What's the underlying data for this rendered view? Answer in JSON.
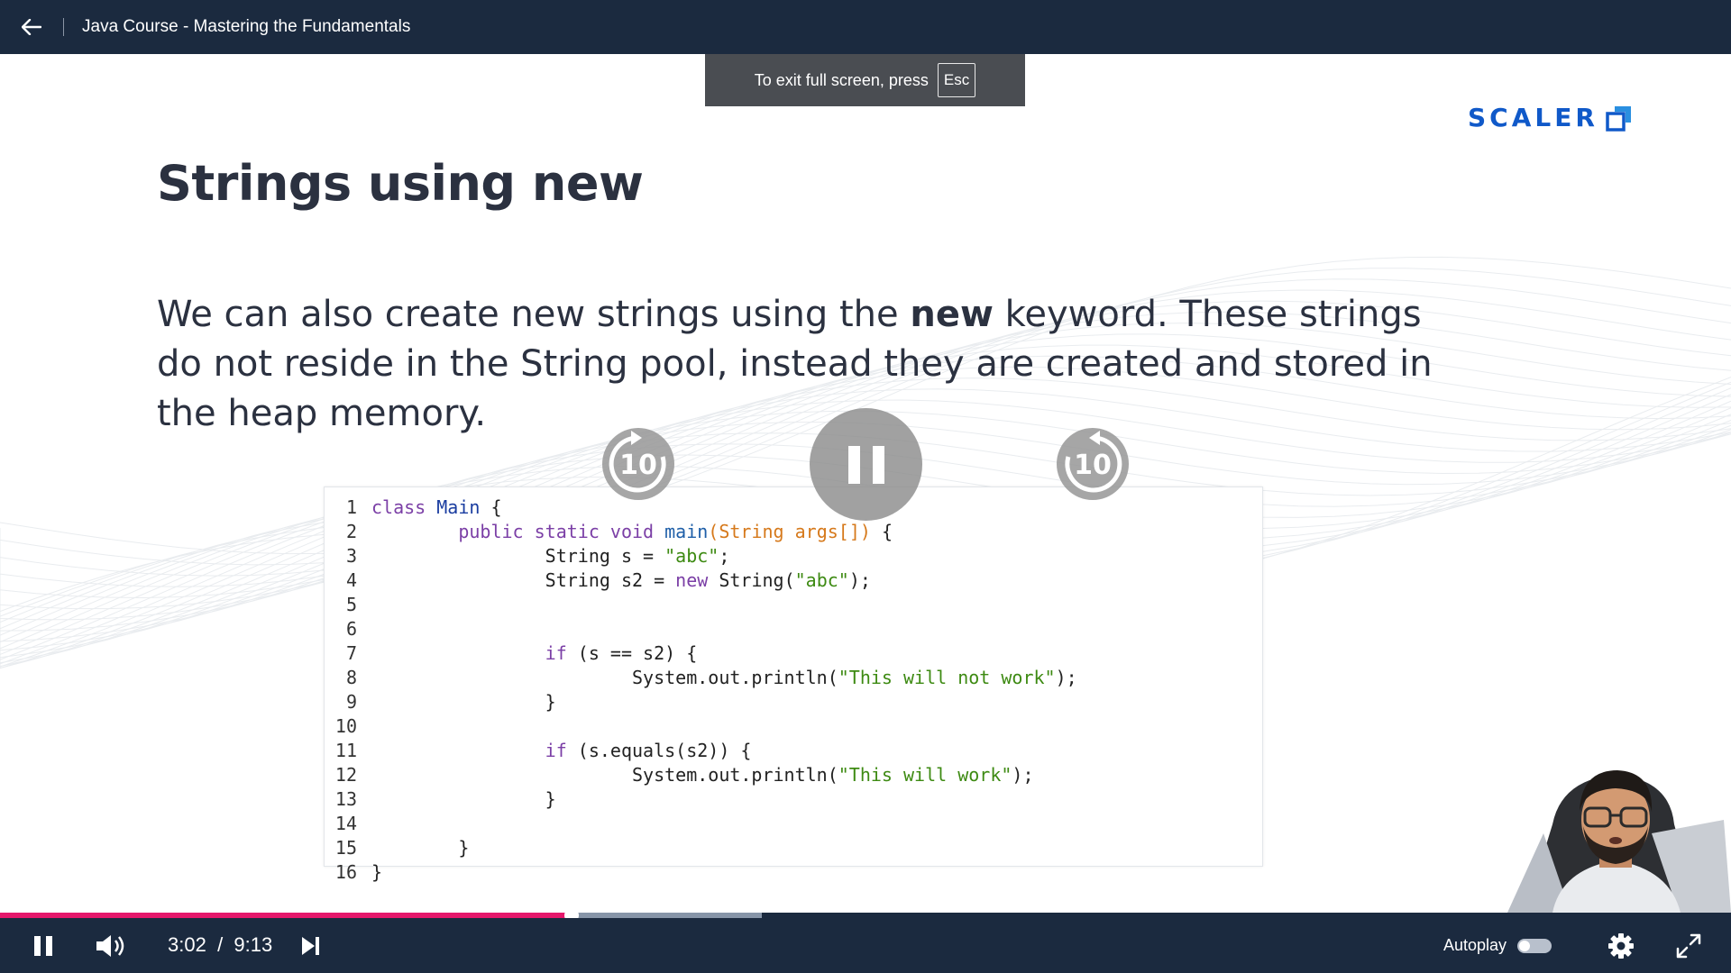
{
  "header": {
    "title": "Java Course - Mastering the Fundamentals"
  },
  "toast": {
    "text": "To exit full screen, press",
    "key": "Esc"
  },
  "slide": {
    "brand": "SCALER",
    "title": "Strings using new",
    "body_before": "We can also create new strings using the ",
    "body_bold": "new",
    "body_after": " keyword. These strings do not reside in the String pool, instead they are created and stored in the heap memory."
  },
  "code": {
    "lines": [
      [
        {
          "t": "class ",
          "c": "kw"
        },
        {
          "t": "Main",
          "c": "cls"
        },
        {
          "t": " {",
          "c": ""
        }
      ],
      [
        {
          "t": "        ",
          "c": ""
        },
        {
          "t": "public static void ",
          "c": "kw"
        },
        {
          "t": "main",
          "c": "fn"
        },
        {
          "t": "(String args[])",
          "c": "arg"
        },
        {
          "t": " {",
          "c": ""
        }
      ],
      [
        {
          "t": "                String s = ",
          "c": ""
        },
        {
          "t": "\"abc\"",
          "c": "str"
        },
        {
          "t": ";",
          "c": ""
        }
      ],
      [
        {
          "t": "                String s2 = ",
          "c": ""
        },
        {
          "t": "new",
          "c": "kw"
        },
        {
          "t": " String(",
          "c": ""
        },
        {
          "t": "\"abc\"",
          "c": "str"
        },
        {
          "t": ");",
          "c": ""
        }
      ],
      [
        {
          "t": "",
          "c": ""
        }
      ],
      [
        {
          "t": "",
          "c": ""
        }
      ],
      [
        {
          "t": "                ",
          "c": ""
        },
        {
          "t": "if",
          "c": "kw"
        },
        {
          "t": " (s == s2) {",
          "c": ""
        }
      ],
      [
        {
          "t": "                        System.out.println(",
          "c": ""
        },
        {
          "t": "\"This will not work\"",
          "c": "str"
        },
        {
          "t": ");",
          "c": ""
        }
      ],
      [
        {
          "t": "                }",
          "c": ""
        }
      ],
      [
        {
          "t": "",
          "c": ""
        }
      ],
      [
        {
          "t": "                ",
          "c": ""
        },
        {
          "t": "if",
          "c": "kw"
        },
        {
          "t": " (s.equals(s2)) {",
          "c": ""
        }
      ],
      [
        {
          "t": "                        System.out.println(",
          "c": ""
        },
        {
          "t": "\"This will work\"",
          "c": "str"
        },
        {
          "t": ");",
          "c": ""
        }
      ],
      [
        {
          "t": "                }",
          "c": ""
        }
      ],
      [
        {
          "t": "",
          "c": ""
        }
      ],
      [
        {
          "t": "        }",
          "c": ""
        }
      ],
      [
        {
          "t": "}",
          "c": ""
        }
      ]
    ]
  },
  "player": {
    "rewind_label": "10",
    "forward_label": "10",
    "current_time": "3:02",
    "separator": "/",
    "duration": "9:13",
    "progress": 0.33,
    "buffered": 0.44,
    "autoplay_label": "Autoplay",
    "autoplay_on": false
  },
  "colors": {
    "header_bg": "#1b2a3f",
    "accent": "#e5176b",
    "brand": "#1059c9"
  }
}
